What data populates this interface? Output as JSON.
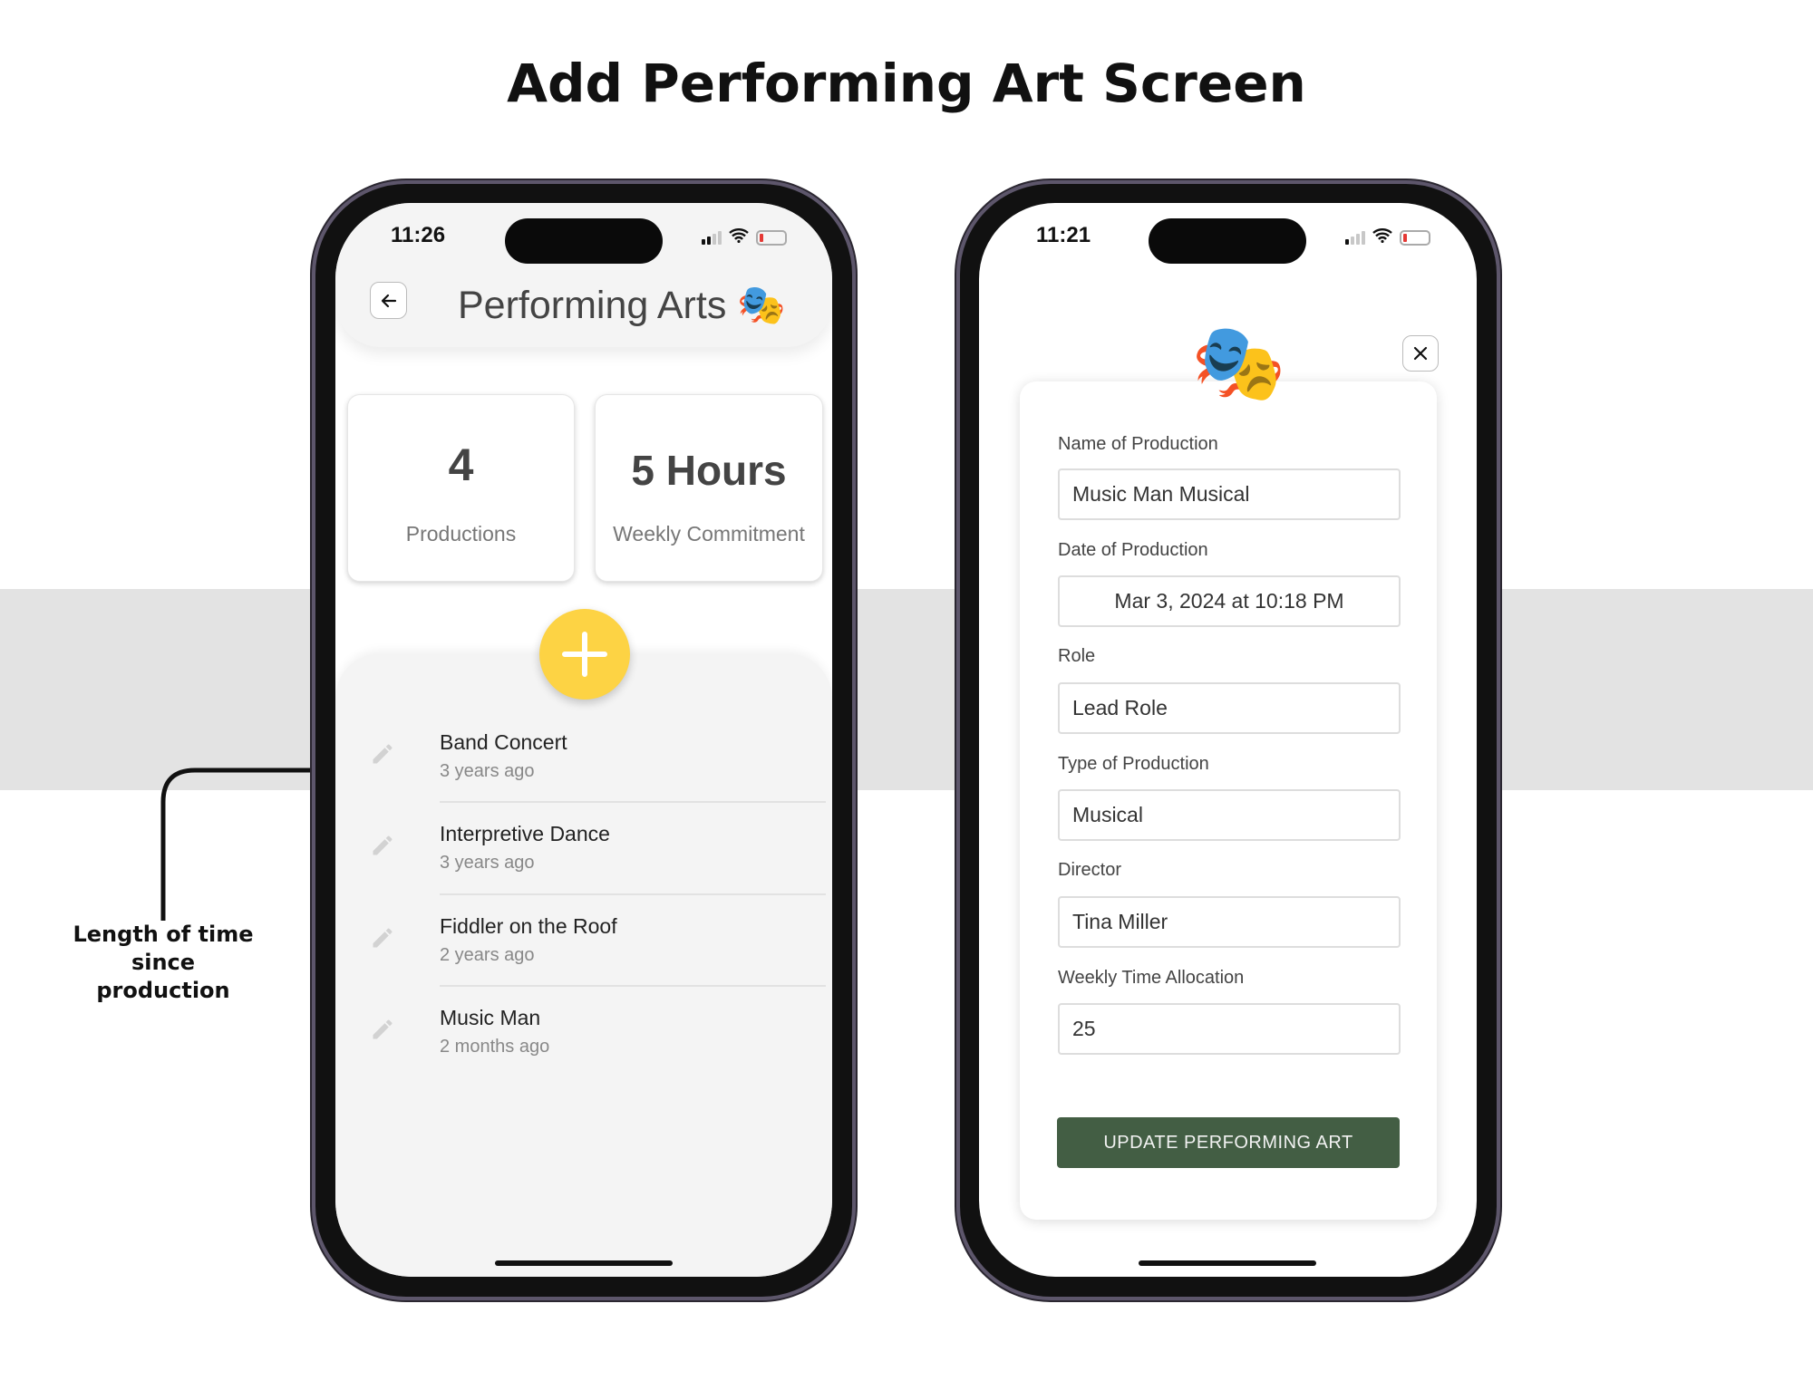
{
  "page_title": "Add Performing Art Screen",
  "annotation": {
    "lines": [
      "Length of time",
      "since",
      "production"
    ]
  },
  "left_phone": {
    "status_time": "11:26",
    "header_title": "Performing Arts",
    "header_emoji": "🎭",
    "stats": [
      {
        "value": "4",
        "label": "Productions"
      },
      {
        "value": "5 Hours",
        "label": "Weekly Commitment"
      }
    ],
    "add_button_color": "#fdd344",
    "items": [
      {
        "title": "Band Concert",
        "subtitle": "3 years ago"
      },
      {
        "title": "Interpretive Dance",
        "subtitle": "3 years ago"
      },
      {
        "title": "Fiddler on the Roof",
        "subtitle": "2 years ago"
      },
      {
        "title": "Music Man",
        "subtitle": "2 months ago"
      }
    ]
  },
  "right_phone": {
    "status_time": "11:21",
    "emoji": "🎭",
    "fields": [
      {
        "label": "Name of Production",
        "value": "Music Man Musical"
      },
      {
        "label": "Date of Production",
        "value": "Mar 3, 2024 at 10:18 PM"
      },
      {
        "label": "Role",
        "value": "Lead Role"
      },
      {
        "label": "Type of Production",
        "value": "Musical"
      },
      {
        "label": "Director",
        "value": "Tina Miller"
      },
      {
        "label": "Weekly Time Allocation",
        "value": "25"
      }
    ],
    "submit_label": "UPDATE PERFORMING ART",
    "submit_color": "#435e44"
  }
}
